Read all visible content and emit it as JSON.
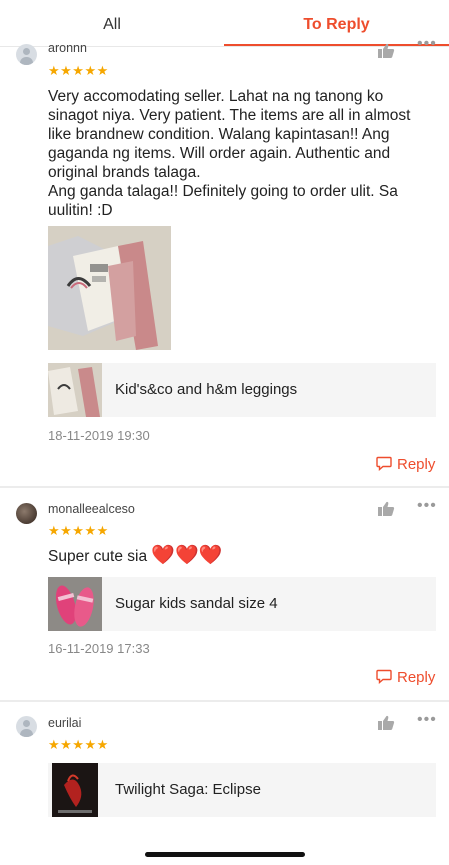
{
  "tabs": {
    "all": "All",
    "to_reply": "To Reply"
  },
  "colors": {
    "accent": "#ee4d2d",
    "star": "#f6a700"
  },
  "icons": [
    "avatar-icon",
    "like-icon",
    "more-icon",
    "reply-icon"
  ],
  "reviews": [
    {
      "username": "aronnn",
      "rating": 5,
      "stars": "★★★★★",
      "text_lines": [
        "Very accomodating seller. Lahat na ng tanong ko",
        "sinagot niya. Very patient. The items are all in almost",
        "like brandnew condition. Walang kapintasan!! Ang",
        "gaganda ng items. Will order again. Authentic and",
        "original brands talaga.",
        "Ang ganda talaga!! Definitely going to order ulit. Sa",
        "uulitin! :D"
      ],
      "product": "Kid's&co and h&m leggings",
      "date": "18-11-2019 19:30",
      "reply": "Reply"
    },
    {
      "username": "monalleealceso",
      "rating": 5,
      "stars": "★★★★★",
      "text": "Super cute sia",
      "hearts": "❤️❤️❤️",
      "product": "Sugar kids sandal size 4",
      "date": "16-11-2019 17:33",
      "reply": "Reply"
    },
    {
      "username": "eurilai",
      "rating": 5,
      "stars": "★★★★★",
      "product": "Twilight Saga: Eclipse"
    }
  ]
}
